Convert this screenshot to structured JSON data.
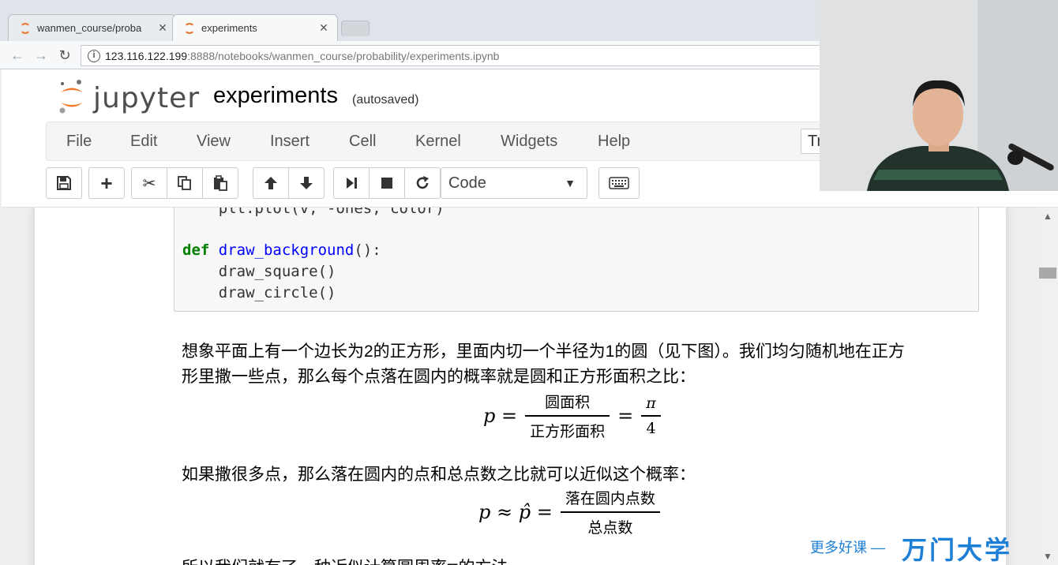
{
  "browser": {
    "tabs": [
      {
        "title": "wanmen_course/proba",
        "active": false
      },
      {
        "title": "experiments",
        "active": true
      }
    ],
    "url_host": "123.116.122.199",
    "url_rest": ":8888/notebooks/wanmen_course/probability/experiments.ipynb"
  },
  "jupyter": {
    "logo_text": "jupyter",
    "notebook_name": "experiments",
    "autosave": "(autosaved)",
    "menu": [
      "File",
      "Edit",
      "View",
      "Insert",
      "Cell",
      "Kernel",
      "Widgets",
      "Help"
    ],
    "trusted": "Tr",
    "cell_type": "Code",
    "accent_color": "#f37626"
  },
  "code_lines": [
    "    plt.plot(v, -ones, color)",
    "",
    "def draw_background():",
    "    draw_square()",
    "    draw_circle()"
  ],
  "markdown": {
    "para1_line1": "想象平面上有一个边长为2的正方形，里面内切一个半径为1的圆（见下图）。我们均匀随机地在正方",
    "para1_line2": "形里撒一些点，那么每个点落在圆内的概率就是圆和正方形面积之比：",
    "f1_lhs": "p =",
    "f1_num": "圆面积",
    "f1_den": "正方形面积",
    "f1_eq": "=",
    "f1_pi": "π",
    "f1_four": "4",
    "para2": "如果撒很多点，那么落在圆内的点和总点数之比就可以近似这个概率：",
    "f2_lhs": "p ≈ p̂ =",
    "f2_num": "落在圆内点数",
    "f2_den": "总点数",
    "para3_partial": "所以我们就有了一种近似计算圆周率π的方法"
  },
  "watermark": {
    "sub": "更多好课 —",
    "main": "万门大学"
  }
}
